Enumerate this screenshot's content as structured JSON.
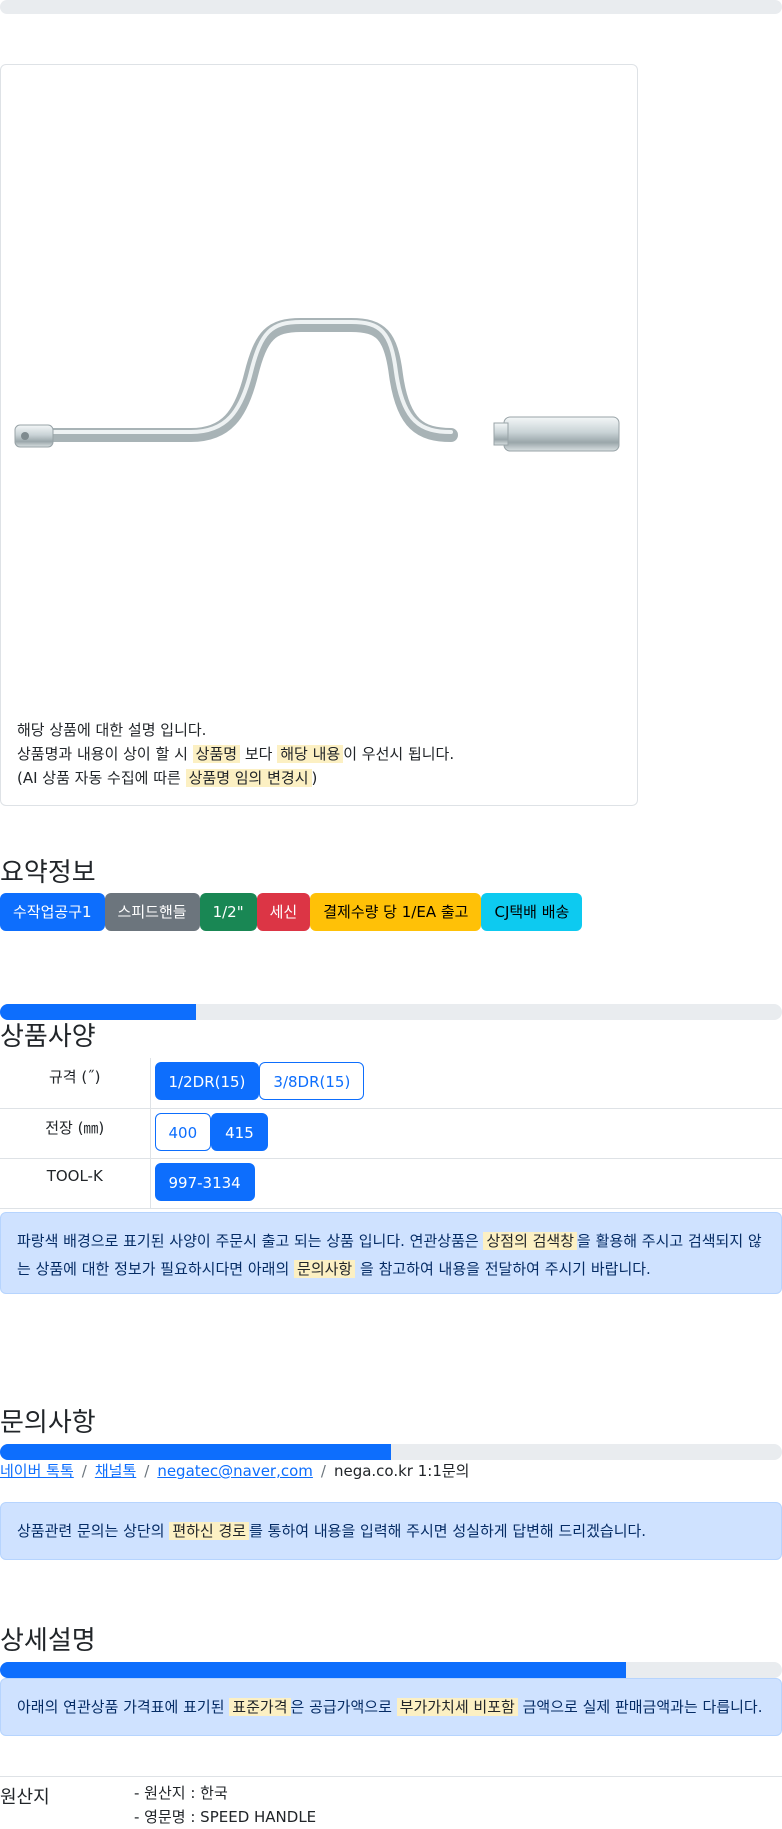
{
  "top_progress": {
    "fill": 0
  },
  "product_card": {
    "image": "speed-handle-wrench",
    "desc_line1": "해당 상품에 대한 설명 입니다.",
    "desc_line2_a": "상품명과 내용이 상이 할 시",
    "desc_line2_mark1": "상품명",
    "desc_line2_b": "보다",
    "desc_line2_mark2": "해당 내용",
    "desc_line2_c": "이 우선시 됩니다.",
    "desc_line3_a": "(AI 상품 자동 수집에 따른",
    "desc_line3_mark": "상품명 임의 변경시",
    "desc_line3_b": ")"
  },
  "summary": {
    "title": "요약정보",
    "badges": [
      "수작업공구1",
      "스피드핸들",
      "1/2\"",
      "세신",
      "결제수량 당 1/EA 출고",
      "CJ택배 배송"
    ]
  },
  "spec": {
    "progress": 0.25,
    "title": "상품사양",
    "rows": [
      {
        "label": "규격 (˝)",
        "options": [
          "1/2DR(15)",
          "3/8DR(15)"
        ]
      },
      {
        "label": "전장 (㎜)",
        "options": [
          "400",
          "415"
        ]
      },
      {
        "label": "TOOL-K",
        "options": [
          "997-3134"
        ]
      }
    ],
    "alert_a": "파랑색 배경으로 표기된 사양이 주문시 출고 되는 상품 입니다. 연관상품은",
    "alert_mark1": "상점의 검색창",
    "alert_b": "을 활용해 주시고 검색되지 않는 상품에 대한 정보가 필요하시다면 아래의",
    "alert_mark2": "문의사항",
    "alert_c": "을 참고하여 내용을 전달하여 주시기 바랍니다."
  },
  "inquiry": {
    "title": "문의사항",
    "progress": 0.5,
    "links": [
      "네이버 톡톡",
      "채널톡",
      "negatec@naver,com"
    ],
    "plain": "nega.co.kr 1:1문의",
    "sep": "/",
    "alert_a": "상품관련 문의는 상단의",
    "alert_mark": "편하신 경로",
    "alert_b": "를 통하여 내용을 입력해 주시면 성실하게 답변해 드리겠습니다."
  },
  "detail": {
    "title": "상세설명",
    "progress": 0.8,
    "alert_a": "아래의 연관상품 가격표에 표기된",
    "alert_mark1": "표준가격",
    "alert_b": "은 공급가액으로",
    "alert_mark2": "부가가치세 비포함",
    "alert_c": "금액으로 실제 판매금액과는 다릅니다."
  },
  "origin": {
    "label": "원산지",
    "line1": "- 원산지 : 한국",
    "line2": "- 영문명 : SPEED HANDLE"
  }
}
